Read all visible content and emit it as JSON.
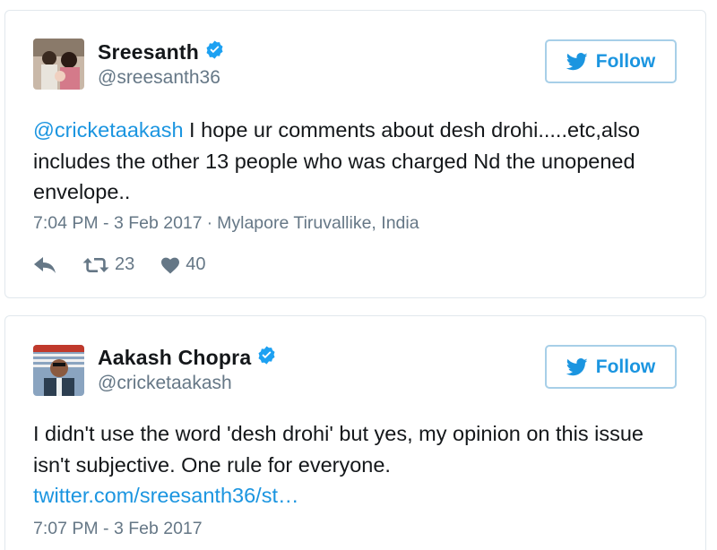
{
  "tweets": [
    {
      "display_name": "Sreesanth",
      "handle": "@sreesanth36",
      "follow_label": "Follow",
      "text_mention": "@cricketaakash",
      "text_body": " I hope ur comments about desh drohi.....etc,also includes the other 13 people who was charged Nd the unopened envelope..",
      "time": "7:04 PM - 3 Feb 2017",
      "separator": "·",
      "location": "Mylapore Tiruvallike, India",
      "retweets": "23",
      "likes": "40",
      "icons": {
        "avatar": "avatar-photo",
        "verified": "verified-badge-icon",
        "reply": "reply-icon",
        "retweet": "retweet-icon",
        "like": "heart-icon",
        "follow": "twitter-bird-icon"
      }
    },
    {
      "display_name": "Aakash Chopra",
      "handle": "@cricketaakash",
      "follow_label": "Follow",
      "text_body": "I didn't use the word 'desh drohi' but yes, my opinion on this issue isn't subjective. One rule for everyone.",
      "link_text": "twitter.com/sreesanth36/st…",
      "time": "7:07 PM - 3 Feb 2017"
    }
  ],
  "colors": {
    "link_blue": "#1b95e0",
    "verified_blue": "#1da1f2",
    "muted_gray": "#657786",
    "border": "#e1e8ed",
    "text": "#14171a"
  }
}
